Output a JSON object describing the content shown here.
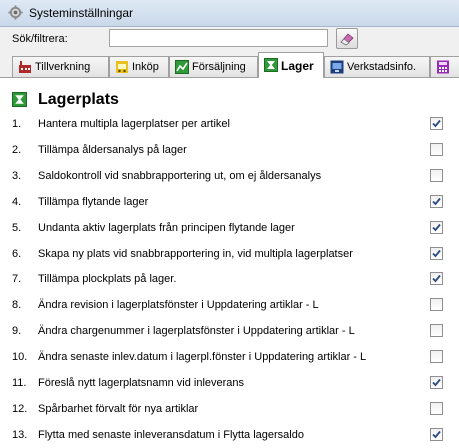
{
  "window": {
    "title": "Systeminställningar"
  },
  "search": {
    "label": "Sök/filtrera:",
    "value": "",
    "placeholder": ""
  },
  "tabs": [
    {
      "label": "Tillverkning",
      "icon": "factory-icon",
      "active": false
    },
    {
      "label": "Inköp",
      "icon": "cart-icon",
      "active": false
    },
    {
      "label": "Försäljning",
      "icon": "chart-icon",
      "active": false
    },
    {
      "label": "Lager",
      "icon": "warehouse-icon",
      "active": true
    },
    {
      "label": "Verkstadsinfo.",
      "icon": "monitor-icon",
      "active": false
    },
    {
      "label": "",
      "icon": "calculator-icon",
      "active": false
    }
  ],
  "section": {
    "title": "Lagerplats",
    "icon": "warehouse-icon"
  },
  "settings": [
    {
      "num": "1.",
      "text": "Hantera multipla lagerplatser per artikel",
      "checked": true
    },
    {
      "num": "2.",
      "text": "Tillämpa åldersanalys på lager",
      "checked": false
    },
    {
      "num": "3.",
      "text": "Saldokontroll vid snabbrapportering ut, om ej åldersanalys",
      "checked": false
    },
    {
      "num": "4.",
      "text": "Tillämpa flytande lager",
      "checked": true
    },
    {
      "num": "5.",
      "text": "Undanta aktiv lagerplats från principen flytande lager",
      "checked": true
    },
    {
      "num": "6.",
      "text": "Skapa ny plats vid snabbrapportering in, vid multipla lagerplatser",
      "checked": true
    },
    {
      "num": "7.",
      "text": "Tillämpa plockplats på lager.",
      "checked": true
    },
    {
      "num": "8.",
      "text": "Ändra revision i lagerplatsfönster i Uppdatering artiklar - L",
      "checked": false
    },
    {
      "num": "9.",
      "text": "Ändra chargenummer i lagerplatsfönster i Uppdatering artiklar - L",
      "checked": false
    },
    {
      "num": "10.",
      "text": "Ändra senaste inlev.datum i lagerpl.fönster i Uppdatering artiklar - L",
      "checked": false
    },
    {
      "num": "11.",
      "text": "Föreslå nytt lagerplatsnamn vid inleverans",
      "checked": true
    },
    {
      "num": "12.",
      "text": "Spårbarhet förvalt för nya artiklar",
      "checked": false
    },
    {
      "num": "13.",
      "text": "Flytta med senaste inleveransdatum i Flytta lagersaldo",
      "checked": true
    }
  ],
  "colors": {
    "check": "#2a4a80",
    "accent": "#3a8a3a"
  }
}
